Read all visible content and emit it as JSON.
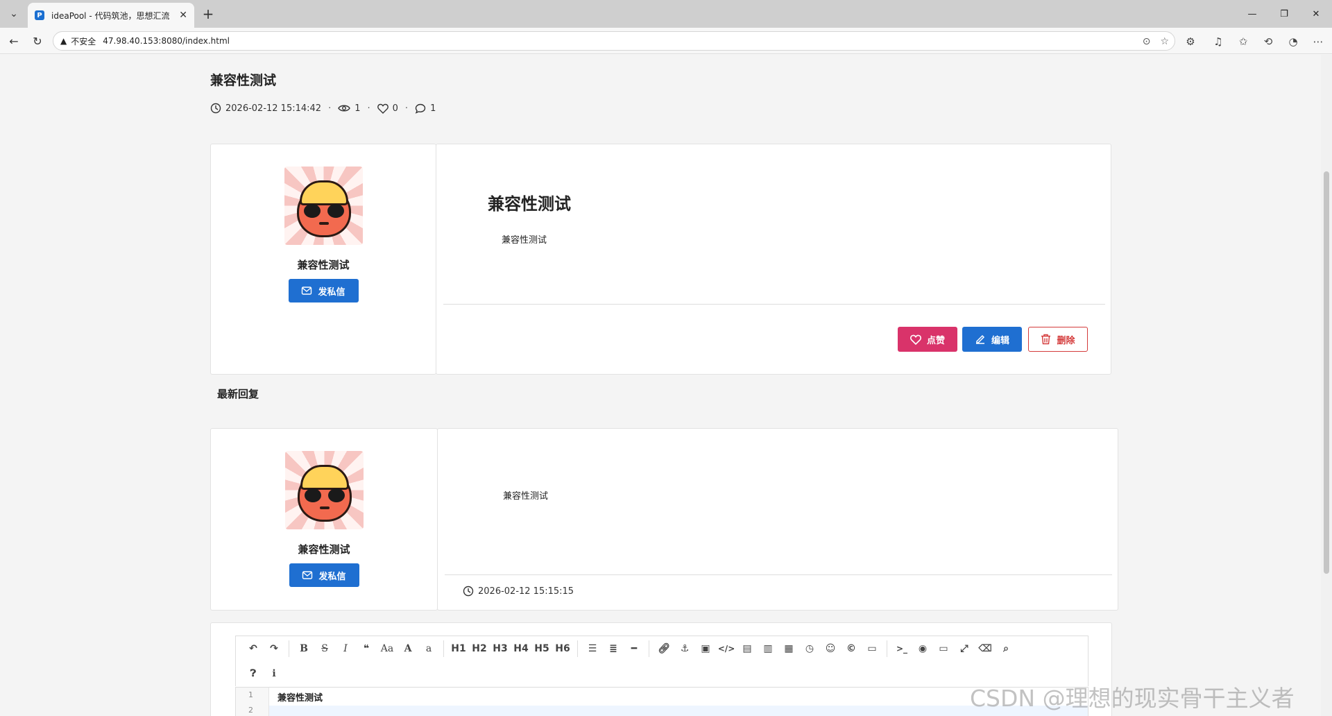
{
  "browser": {
    "tab_title": "ideaPool - 代码筑池，思想汇流",
    "tab_favicon_letter": "P",
    "address_insecure": "不安全",
    "url": "47.98.40.153:8080/index.html"
  },
  "post": {
    "title": "兼容性测试",
    "datetime": "2026-02-12 15:14:42",
    "views": "1",
    "likes": "0",
    "comments": "1",
    "author": {
      "name": "兼容性测试",
      "message_button": "发私信"
    },
    "content_heading": "兼容性测试",
    "content_body": "兼容性测试",
    "actions": {
      "like": "点赞",
      "edit": "编辑",
      "delete": "删除"
    }
  },
  "replies": {
    "section_title": "最新回复",
    "items": [
      {
        "author_name": "兼容性测试",
        "message_button": "发私信",
        "content": "兼容性测试",
        "datetime": "2026-02-12 15:15:15"
      }
    ]
  },
  "editor": {
    "toolbar": {
      "headings": [
        "H1",
        "H2",
        "H3",
        "H4",
        "H5",
        "H6"
      ],
      "bold": "B",
      "strike": "S",
      "italic": "I",
      "case_upper": "Aa",
      "case_a": "A",
      "case_lower": "a"
    },
    "lines": [
      "1",
      "2"
    ],
    "line1_text": "兼容性测试"
  },
  "watermark": "CSDN @理想的现实骨干主义者",
  "colors": {
    "primary": "#1f6fd1",
    "like": "#d9336a",
    "delete": "#d43a3a"
  }
}
